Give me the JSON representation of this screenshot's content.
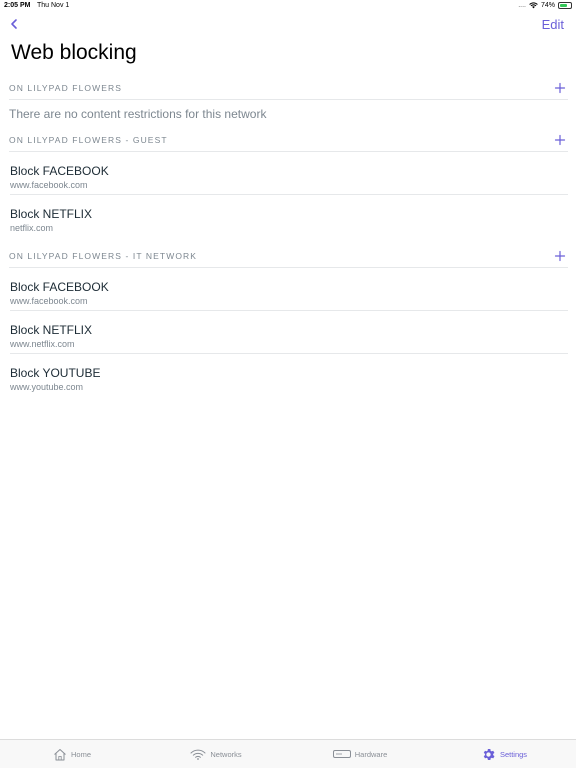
{
  "status": {
    "time": "2:05 PM",
    "date": "Thu Nov 1",
    "dots": "....",
    "battery": "74%"
  },
  "nav": {
    "edit_label": "Edit",
    "title": "Web blocking"
  },
  "sections": [
    {
      "title": "ON LILYPAD FLOWERS",
      "empty_message": "There are no content restrictions for this network",
      "items": []
    },
    {
      "title": "ON LILYPAD FLOWERS - GUEST",
      "items": [
        {
          "title": "Block FACEBOOK",
          "subtitle": "www.facebook.com"
        },
        {
          "title": "Block NETFLIX",
          "subtitle": "netflix.com"
        }
      ]
    },
    {
      "title": "ON LILYPAD FLOWERS - IT NETWORK",
      "items": [
        {
          "title": "Block FACEBOOK",
          "subtitle": "www.facebook.com"
        },
        {
          "title": "Block NETFLIX",
          "subtitle": "www.netflix.com"
        },
        {
          "title": "Block YOUTUBE",
          "subtitle": "www.youtube.com"
        }
      ]
    }
  ],
  "tabs": [
    {
      "label": "Home",
      "icon": "home-icon"
    },
    {
      "label": "Networks",
      "icon": "wifi-icon"
    },
    {
      "label": "Hardware",
      "icon": "hardware-icon"
    },
    {
      "label": "Settings",
      "icon": "gear-icon",
      "active": true
    }
  ],
  "colors": {
    "accent": "#6a5fd8",
    "text": "#1c2b35",
    "muted": "#7d8790",
    "battery": "#34c759"
  }
}
